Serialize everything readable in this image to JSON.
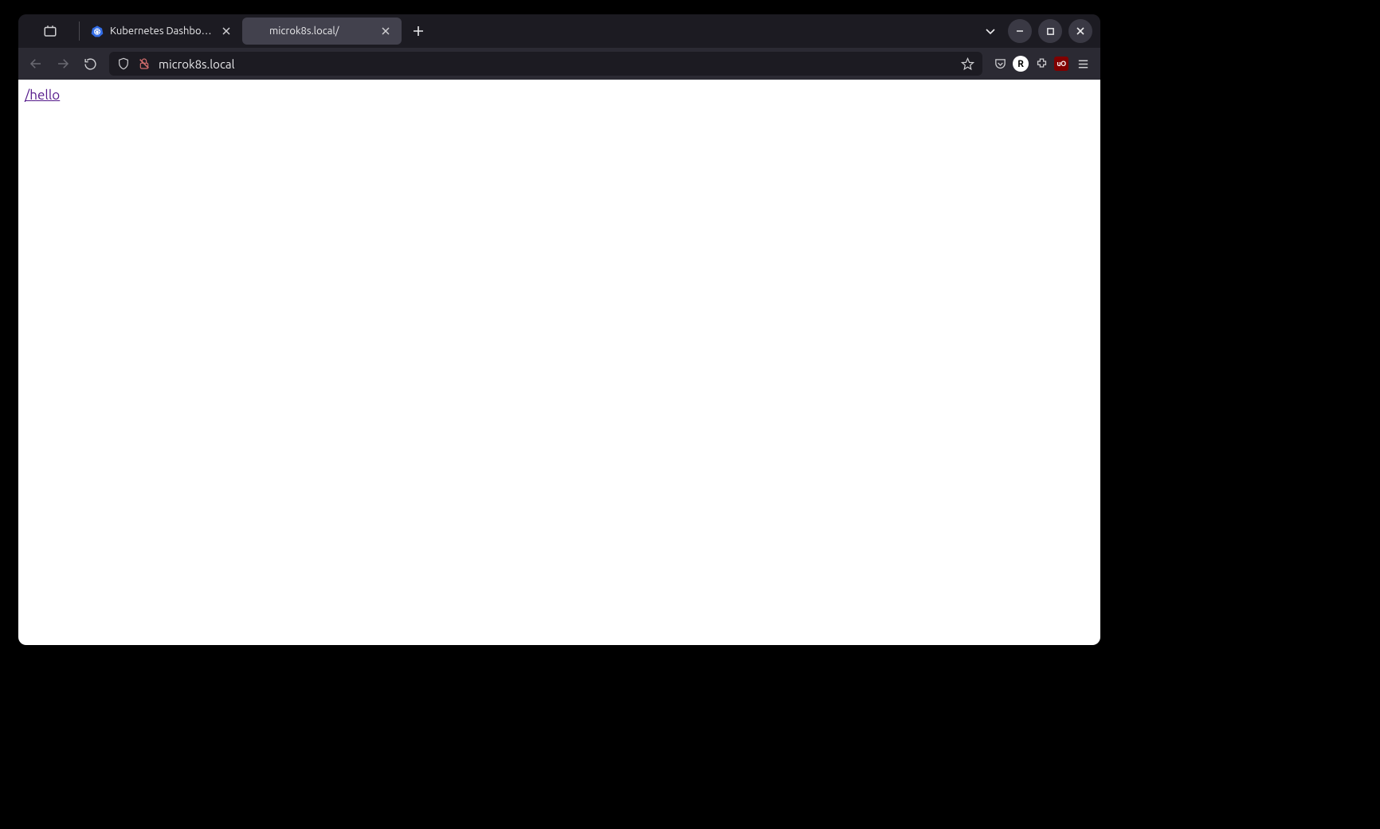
{
  "tabs": [
    {
      "title": "Kubernetes Dashboard",
      "active": false,
      "favicon": "k8s"
    },
    {
      "title": "microk8s.local/",
      "active": true,
      "favicon": "none"
    }
  ],
  "addressbar": {
    "url_display": "microk8s.local"
  },
  "page": {
    "link_text": "/hello"
  },
  "ext_r_label": "R",
  "ext_ublock_label": "uO"
}
